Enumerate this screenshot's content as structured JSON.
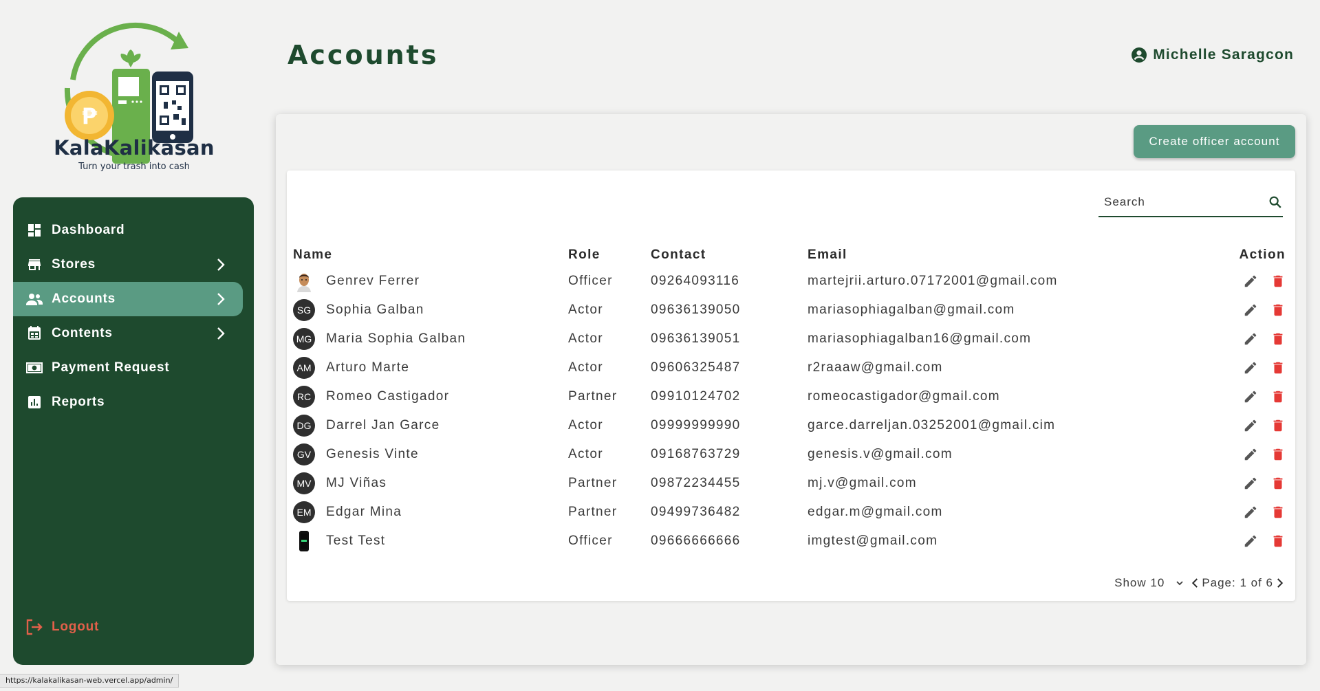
{
  "brand": {
    "name": "KalaKalikasan",
    "tagline": "Turn your trash into cash",
    "logo_icon": "recycle-phone-qr-logo"
  },
  "header": {
    "title": "Accounts",
    "user_name": "Michelle Saragcon"
  },
  "sidebar": {
    "items": [
      {
        "label": "Dashboard",
        "icon": "dashboard-icon",
        "has_submenu": false,
        "active": false
      },
      {
        "label": "Stores",
        "icon": "store-icon",
        "has_submenu": true,
        "active": false
      },
      {
        "label": "Accounts",
        "icon": "people-icon",
        "has_submenu": true,
        "active": true
      },
      {
        "label": "Contents",
        "icon": "calendar-icon",
        "has_submenu": true,
        "active": false
      },
      {
        "label": "Payment Request",
        "icon": "payment-icon",
        "has_submenu": false,
        "active": false
      },
      {
        "label": "Reports",
        "icon": "reports-icon",
        "has_submenu": false,
        "active": false
      }
    ],
    "logout_label": "Logout"
  },
  "toolbar": {
    "create_label": "Create officer account"
  },
  "search": {
    "placeholder": "Search"
  },
  "table": {
    "columns": [
      "Name",
      "Role",
      "Contact",
      "Email",
      "Action"
    ],
    "rows": [
      {
        "avatar": "photo",
        "initials": "",
        "name": "Genrev Ferrer",
        "role": "Officer",
        "contact": "09264093116",
        "email": "martejrii.arturo.07172001@gmail.com"
      },
      {
        "avatar": "initials",
        "initials": "SG",
        "name": "Sophia Galban",
        "role": "Actor",
        "contact": "09636139050",
        "email": "mariasophiagalban@gmail.com"
      },
      {
        "avatar": "initials",
        "initials": "MG",
        "name": "Maria Sophia Galban",
        "role": "Actor",
        "contact": "09636139051",
        "email": "mariasophiagalban16@gmail.com"
      },
      {
        "avatar": "initials",
        "initials": "AM",
        "name": "Arturo Marte",
        "role": "Actor",
        "contact": "09606325487",
        "email": "r2raaaw@gmail.com"
      },
      {
        "avatar": "initials",
        "initials": "RC",
        "name": "Romeo Castigador",
        "role": "Partner",
        "contact": "09910124702",
        "email": "romeocastigador@gmail.com"
      },
      {
        "avatar": "initials",
        "initials": "DG",
        "name": "Darrel Jan Garce",
        "role": "Actor",
        "contact": "09999999990",
        "email": "garce.darreljan.03252001@gmail.cim"
      },
      {
        "avatar": "initials",
        "initials": "GV",
        "name": "Genesis Vinte",
        "role": "Actor",
        "contact": "09168763729",
        "email": "genesis.v@gmail.com"
      },
      {
        "avatar": "initials",
        "initials": "MV",
        "name": "MJ Viñas",
        "role": "Partner",
        "contact": "09872234455",
        "email": "mj.v@gmail.com"
      },
      {
        "avatar": "initials",
        "initials": "EM",
        "name": "Edgar Mina",
        "role": "Partner",
        "contact": "09499736482",
        "email": "edgar.m@gmail.com"
      },
      {
        "avatar": "phone",
        "initials": "",
        "name": "Test Test",
        "role": "Officer",
        "contact": "09666666666",
        "email": "imgtest@gmail.com"
      }
    ]
  },
  "pagination": {
    "show_label": "Show 10",
    "page_label": "Page: 1 of 6"
  },
  "status_bar": {
    "url": "https://kalakalikasan-web.vercel.app/admin/"
  },
  "colors": {
    "sidebar_bg": "#1e4a2e",
    "accent": "#5a9b83",
    "delete": "#e53935",
    "logout": "#e2604a"
  }
}
